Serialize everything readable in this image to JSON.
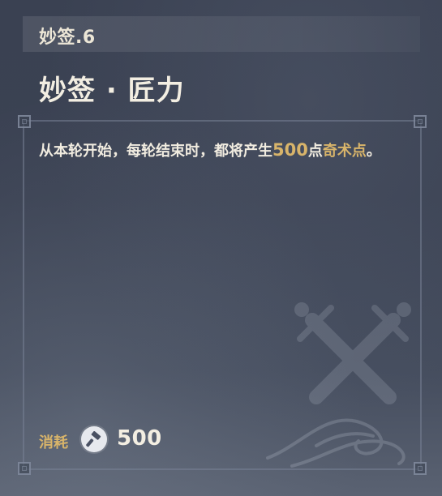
{
  "header": {
    "level_label": "妙签.6"
  },
  "card": {
    "title": "妙签 · 匠力"
  },
  "description": {
    "part1": "从本轮开始，每轮结束时，都将产生",
    "amount": "500",
    "part2": "点",
    "highlight": "奇术点",
    "end": "。"
  },
  "cost": {
    "label": "消耗",
    "icon": "hammer-icon",
    "value": "500"
  },
  "colors": {
    "gold_accent": "#d8b46a",
    "text_light": "#f3eee2",
    "background": "#3b4253"
  }
}
